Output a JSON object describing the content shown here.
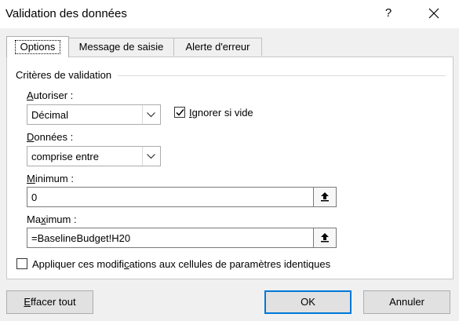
{
  "window": {
    "title": "Validation des données",
    "help_label": "?"
  },
  "tabs": [
    {
      "label": "Options",
      "active": true
    },
    {
      "label": "Message de saisie",
      "active": false
    },
    {
      "label": "Alerte d'erreur",
      "active": false
    }
  ],
  "criteria": {
    "group_label": "Critères de validation",
    "allow": {
      "label_pre": "",
      "label_u": "A",
      "label_post": "utoriser :",
      "value": "Décimal"
    },
    "ignore_blank": {
      "label_pre": "",
      "label_u": "I",
      "label_post": "gnorer si vide",
      "checked": true
    },
    "data": {
      "label_pre": "",
      "label_u": "D",
      "label_post": "onnées :",
      "value": "comprise entre"
    },
    "minimum": {
      "label_pre": "",
      "label_u": "M",
      "label_post": "inimum :",
      "value": "0"
    },
    "maximum": {
      "label_pre": "Ma",
      "label_u": "x",
      "label_post": "imum :",
      "value": "=BaselineBudget!H20"
    },
    "apply_all": {
      "label_pre": "Appliquer ces modifi",
      "label_u": "c",
      "label_post": "ations aux cellules de paramètres identiques",
      "checked": false
    }
  },
  "buttons": {
    "clear_pre": "",
    "clear_u": "E",
    "clear_post": "ffacer tout",
    "ok": "OK",
    "cancel": "Annuler"
  },
  "icons": {
    "help": "help-icon",
    "close": "close-icon",
    "dropdown": "chevron-down-icon",
    "collapse": "collapse-dialog-icon",
    "check": "checkmark-icon"
  }
}
